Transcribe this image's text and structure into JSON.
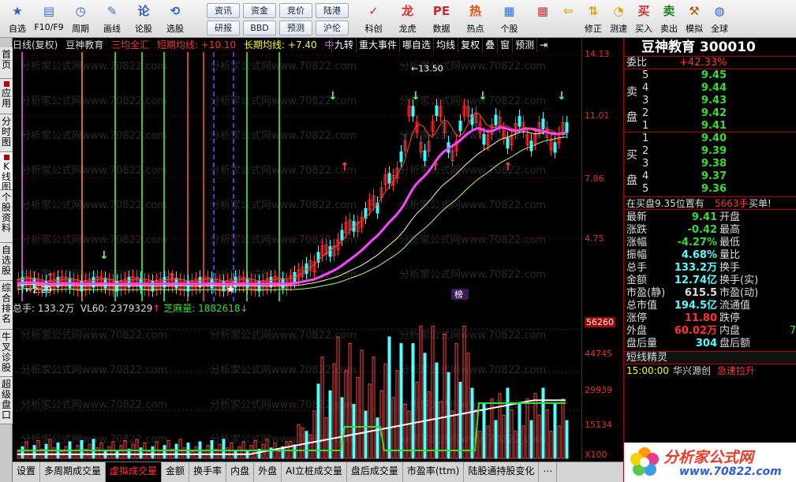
{
  "toolbar": {
    "buttons": [
      {
        "label": "自选",
        "icon": "star-icon",
        "glyph": "★",
        "color": "#2a5cd8"
      },
      {
        "label": "F10/F9",
        "icon": "document-icon",
        "glyph": "▤",
        "color": "#3a6fd0"
      },
      {
        "label": "周期",
        "icon": "clock-icon",
        "glyph": "◷",
        "color": "#2a5cd8"
      },
      {
        "label": "画线",
        "icon": "pencil-icon",
        "glyph": "✎",
        "color": "#3a6fd0"
      },
      {
        "label": "论股",
        "icon": "forum-icon",
        "glyph": "论",
        "color": "#2a5cd8"
      },
      {
        "label": "选股",
        "icon": "chart-select-icon",
        "glyph": "⟲",
        "color": "#2a5cd8"
      }
    ],
    "small_buttons": [
      "资讯",
      "资金",
      "竞价",
      "陆港",
      "研报",
      "BBD",
      "预测",
      "沪伦"
    ],
    "buttons2": [
      {
        "label": "科创",
        "icon": "science-icon",
        "glyph": "✓",
        "color": "#d03030"
      },
      {
        "label": "龙虎",
        "icon": "dragon-icon",
        "glyph": "龙",
        "color": "#d03030"
      },
      {
        "label": "数据",
        "icon": "pe-icon",
        "glyph": "PE",
        "color": "#c03030"
      },
      {
        "label": "热点",
        "icon": "fire-icon",
        "glyph": "热",
        "color": "#e05010"
      },
      {
        "label": "个股",
        "icon": "stock-icon",
        "glyph": "▦",
        "color": "#3a6fd0"
      }
    ],
    "buttons3": [
      {
        "label": "",
        "icon": "grid-icon",
        "glyph": "▦",
        "color": "#d03030"
      },
      {
        "label": "",
        "icon": "back-arrow-icon",
        "glyph": "⇦",
        "color": "#e6a000"
      },
      {
        "label": "修正",
        "icon": "up-down-icon",
        "glyph": "⇅",
        "color": "#e6a000"
      },
      {
        "label": "测速",
        "icon": "speed-icon",
        "glyph": "◔",
        "color": "#e6a000"
      },
      {
        "label": "买入",
        "icon": "buy-icon",
        "glyph": "买",
        "color": "#d03030"
      },
      {
        "label": "卖出",
        "icon": "sell-icon",
        "glyph": "卖",
        "color": "#208020"
      },
      {
        "label": "模拟",
        "icon": "hammer-icon",
        "glyph": "⚒",
        "color": "#b05010"
      },
      {
        "label": "全球",
        "icon": "globe-icon",
        "glyph": "◍",
        "color": "#2a5cd8"
      }
    ]
  },
  "left_tabs": [
    "首页",
    "应用",
    "分时图",
    "K线图",
    "个股资料",
    "自选股",
    "综合排名",
    "牛叉诊股",
    "超级盘口"
  ],
  "chart_header": {
    "period": "日线(复权)",
    "name": "豆神教育",
    "indicator": "三均全汇",
    "short_label": "短期均线:",
    "short_val": "+10.10",
    "long_label": "长期均线:",
    "long_val": "+7.40",
    "mid": "中"
  },
  "chart_menu": [
    "九转",
    "重大事件",
    "哪自选",
    "均线",
    "复权",
    "叠",
    "窗",
    "预测",
    "⇥"
  ],
  "watermark": "分析家公式网www.70822.com",
  "chart_annotations": {
    "high": "13.50",
    "low": "2.29",
    "bang": "榜"
  },
  "volume_header": {
    "total": "总手: 133.2万",
    "vl60": "VL60: 2379329",
    "zhima": "芝麻量: 1882618"
  },
  "y_axis_main": [
    "14.13",
    "11.01",
    "7.86",
    "4.75"
  ],
  "y_axis_vol": [
    "56260",
    "44745",
    "29939",
    "15134",
    "X100"
  ],
  "bottom_tabs": [
    "设置",
    "多周期成交量",
    "虚拟成交量",
    "金额",
    "换手率",
    "内盘",
    "外盘",
    "AI立桩成交量",
    "盘后成交量",
    "市盈率(ttm)",
    "陆股通持股变化",
    "⋯"
  ],
  "active_bottom_tab": "虚拟成交量",
  "stock": {
    "name": "豆神教育",
    "code": "300010",
    "title": "豆神教育 300010",
    "weibi_label": "委比",
    "weibi": "+42.33%",
    "sell_side": "卖盘",
    "buy_side": "买盘",
    "asks": [
      {
        "level": "5",
        "price": "9.45"
      },
      {
        "level": "4",
        "price": "9.44"
      },
      {
        "level": "3",
        "price": "9.43"
      },
      {
        "level": "2",
        "price": "9.42"
      },
      {
        "level": "1",
        "price": "9.41"
      }
    ],
    "bids": [
      {
        "level": "1",
        "price": "9.40"
      },
      {
        "level": "2",
        "price": "9.39"
      },
      {
        "level": "3",
        "price": "9.38"
      },
      {
        "level": "4",
        "price": "9.37"
      },
      {
        "level": "5",
        "price": "9.36"
      }
    ],
    "msg_pre": "在买盘9.35位置有",
    "msg_qty": "5663手",
    "msg_post": "买单!",
    "stats": [
      [
        "最新",
        "9.41",
        "开盘",
        ""
      ],
      [
        "涨跌",
        "-0.42",
        "最高",
        ""
      ],
      [
        "涨幅",
        "-4.27%",
        "最低",
        ""
      ],
      [
        "振幅",
        "4.68%",
        "量比",
        ""
      ],
      [
        "总手",
        "133.2万",
        "换手",
        ""
      ],
      [
        "金额",
        "12.74亿",
        "换手(实)",
        ""
      ],
      [
        "市盈(静)",
        "615.5",
        "市盈(动)",
        ""
      ],
      [
        "总市值",
        "194.5亿",
        "流通值",
        ""
      ],
      [
        "涨停",
        "11.80",
        "跌停",
        ""
      ],
      [
        "外盘",
        "60.02万",
        "内盘",
        "7"
      ],
      [
        "盘后量",
        "304",
        "盘后额",
        ""
      ]
    ],
    "jingling_title": "短线精灵",
    "jingling": [
      {
        "time": "15:00:00",
        "stock": "华兴源创",
        "event": "急速拉升"
      }
    ],
    "brand": "分析家公式网",
    "brand_url": "www.70822.com"
  },
  "colors": {
    "up": "#ff3333",
    "down": "#33dd33",
    "ma_pink": "#ff44ff",
    "ma_yellow": "#ffff66",
    "vol_cyan": "#55ffff"
  }
}
